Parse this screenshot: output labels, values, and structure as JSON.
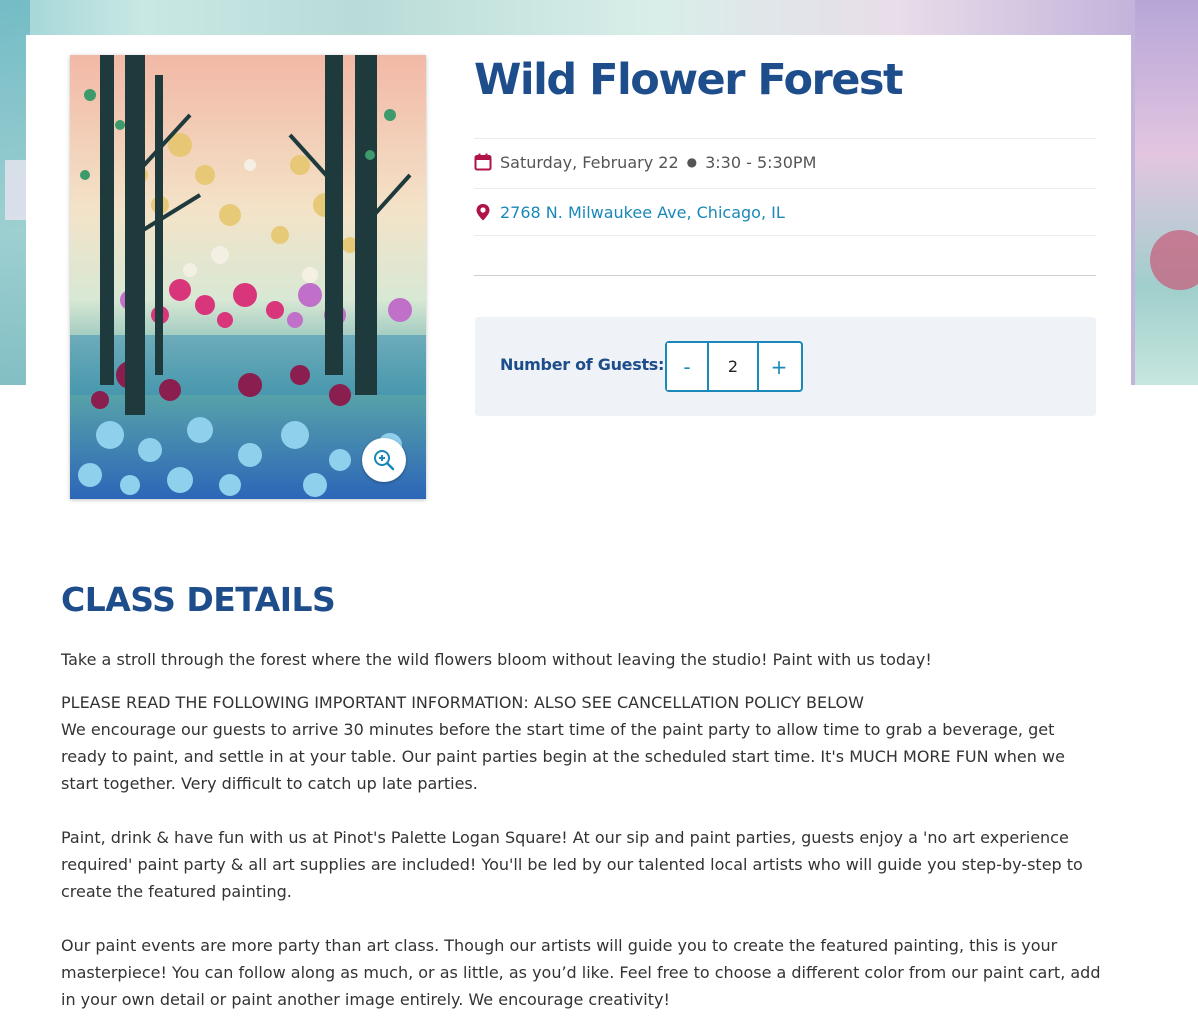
{
  "event": {
    "title": "Wild Flower Forest",
    "date": "Saturday, February 22",
    "time": "3:30 - 5:30PM",
    "location": "2768 N. Milwaukee Ave, Chicago, IL"
  },
  "guests": {
    "label": "Number of Guests:",
    "minus": "-",
    "value": "2",
    "plus": "+"
  },
  "details": {
    "heading": "CLASS DETAILS",
    "intro": "Take a stroll through the forest where the wild flowers bloom without leaving the studio! Paint with us today!",
    "notice_heading": "PLEASE READ THE FOLLOWING IMPORTANT INFORMATION: ALSO SEE CANCELLATION POLICY BELOW",
    "notice_body": "We encourage our guests to arrive 30 minutes before the start time of the paint party to allow time to grab a beverage, get ready to paint, and settle in at your table. Our paint parties begin at the scheduled start time. It's MUCH MORE FUN when we start together. Very difficult to catch up late parties.",
    "para2": "Paint, drink & have fun with us at Pinot's Palette Logan Square! At our sip and paint parties, guests enjoy a 'no art experience required' paint party & all art supplies are included! You'll be led by our talented local artists who will guide you step-by-step to create the featured painting.",
    "para3": "Our paint events are more party than art class. Though our artists will guide you to create the featured painting, this is your masterpiece! You can follow along as much, or as little, as you’d like. Feel free to choose a different color from our paint cart, add in your own detail or paint another image entirely. We encourage creativity!"
  },
  "colors": {
    "title": "#1e4d8c",
    "accent": "#1a88b8",
    "icon": "#b0124a"
  },
  "icons": {
    "date": "calendar-icon",
    "location": "map-pin-icon",
    "zoom": "zoom-in-icon"
  }
}
